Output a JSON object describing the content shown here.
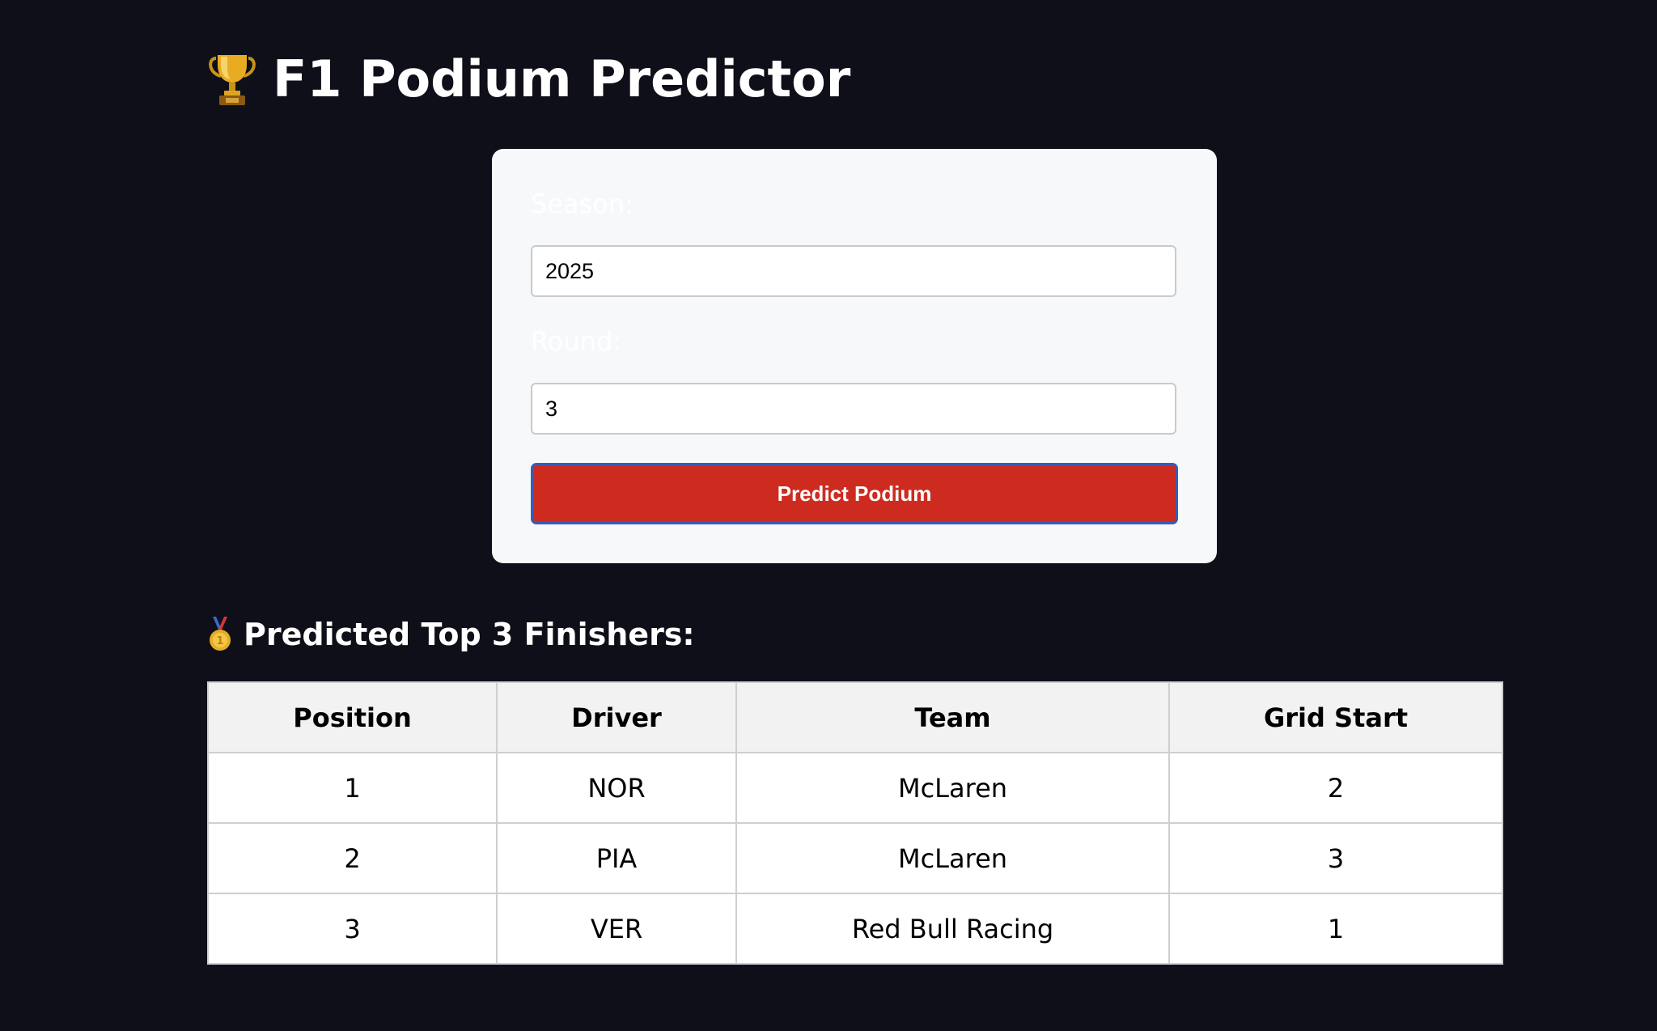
{
  "header": {
    "title": "F1 Podium Predictor",
    "icon": "trophy-icon"
  },
  "form": {
    "season_label": "Season:",
    "season_value": "2025",
    "round_label": "Round:",
    "round_value": "3",
    "predict_label": "Predict Podium"
  },
  "results": {
    "heading": "Predicted Top 3 Finishers:",
    "icon": "medal-icon",
    "columns": [
      "Position",
      "Driver",
      "Team",
      "Grid Start"
    ],
    "rows": [
      [
        "1",
        "NOR",
        "McLaren",
        "2"
      ],
      [
        "2",
        "PIA",
        "McLaren",
        "3"
      ],
      [
        "3",
        "VER",
        "Red Bull Racing",
        "1"
      ]
    ]
  },
  "colors": {
    "background": "#0e0f18",
    "card": "#f7f8fa",
    "button": "#cd2b1f",
    "button_border": "#3a5ab8"
  }
}
